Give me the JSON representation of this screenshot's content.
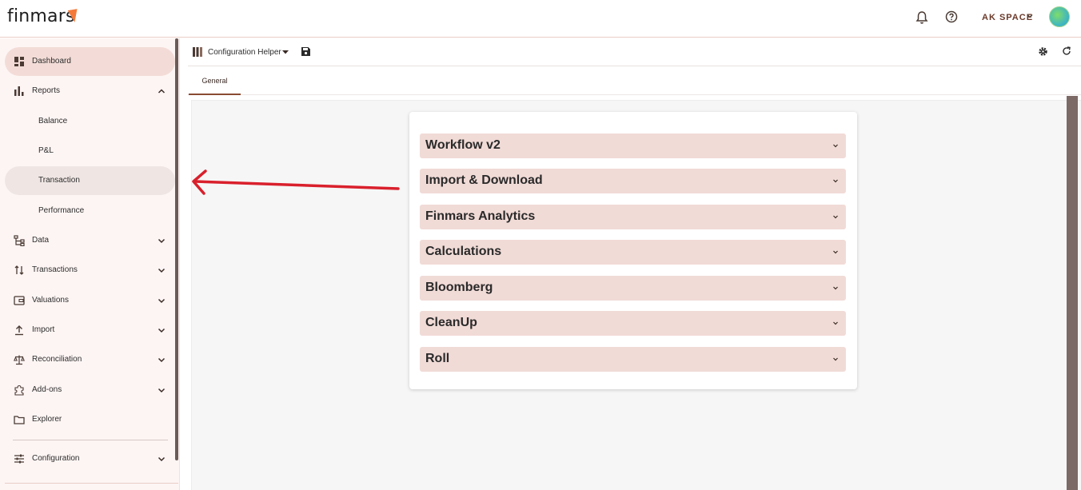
{
  "app": {
    "logo_text": "finmars",
    "space_name": "AK SPACE"
  },
  "sidebar": {
    "items": [
      {
        "label": "Dashboard"
      },
      {
        "label": "Reports"
      },
      {
        "label": "Balance"
      },
      {
        "label": "P&L"
      },
      {
        "label": "Transaction"
      },
      {
        "label": "Performance"
      },
      {
        "label": "Data"
      },
      {
        "label": "Transactions"
      },
      {
        "label": "Valuations"
      },
      {
        "label": "Import"
      },
      {
        "label": "Reconciliation"
      },
      {
        "label": "Add-ons"
      },
      {
        "label": "Explorer"
      },
      {
        "label": "Configuration"
      }
    ]
  },
  "toolbar": {
    "title": "Configuration Helper"
  },
  "tabs": [
    {
      "label": "General"
    }
  ],
  "accordion": [
    {
      "label": "Workflow v2"
    },
    {
      "label": "Import & Download"
    },
    {
      "label": "Finmars Analytics"
    },
    {
      "label": "Calculations"
    },
    {
      "label": "Bloomberg"
    },
    {
      "label": "CleanUp"
    },
    {
      "label": "Roll"
    }
  ],
  "colors": {
    "accent": "#8a4b32",
    "active_bg": "#f3dcd7",
    "accordion_bg": "#f1dbd7",
    "annotation_arrow": "#d9202c"
  }
}
